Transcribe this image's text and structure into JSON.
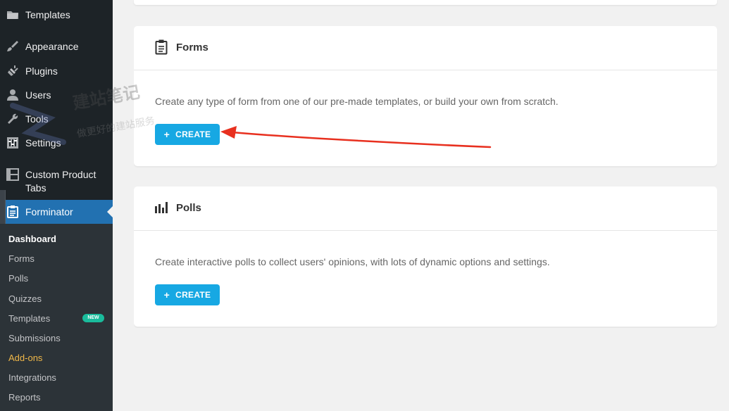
{
  "sidebar": {
    "menu": [
      {
        "label": "Templates",
        "icon": "folder-icon"
      },
      {
        "label": "Appearance",
        "icon": "paintbrush-icon"
      },
      {
        "label": "Plugins",
        "icon": "plug-icon"
      },
      {
        "label": "Users",
        "icon": "user-icon"
      },
      {
        "label": "Tools",
        "icon": "wrench-icon"
      },
      {
        "label": "Settings",
        "icon": "sliders-icon"
      },
      {
        "label_line1": "Custom Product",
        "label_line2": "Tabs",
        "icon": "table-icon"
      },
      {
        "label": "Forminator",
        "icon": "clipboard-icon",
        "active": true
      }
    ],
    "submenu": [
      {
        "label": "Dashboard"
      },
      {
        "label": "Forms"
      },
      {
        "label": "Polls"
      },
      {
        "label": "Quizzes"
      },
      {
        "label": "Templates",
        "badge": "NEW"
      },
      {
        "label": "Submissions"
      },
      {
        "label": "Add-ons"
      },
      {
        "label": "Integrations"
      },
      {
        "label": "Reports"
      }
    ]
  },
  "forms_card": {
    "title": "Forms",
    "description": "Create any type of form from one of our pre-made templates, or build your own from scratch.",
    "button": "CREATE",
    "button_icon": "+"
  },
  "polls_card": {
    "title": "Polls",
    "description": "Create interactive polls to collect users' opinions, with lots of dynamic options and settings.",
    "button": "CREATE",
    "button_icon": "+"
  },
  "watermark": {
    "line1": "建站笔记",
    "line2": "做更好的建站服务"
  },
  "colors": {
    "sidebar_bg": "#1d2327",
    "submenu_bg": "#2c3338",
    "active_bg": "#2271b1",
    "button_bg": "#17a8e3",
    "badge_bg": "#1abc9c",
    "addons_color": "#f0b849",
    "arrow_color": "#e8301f"
  }
}
